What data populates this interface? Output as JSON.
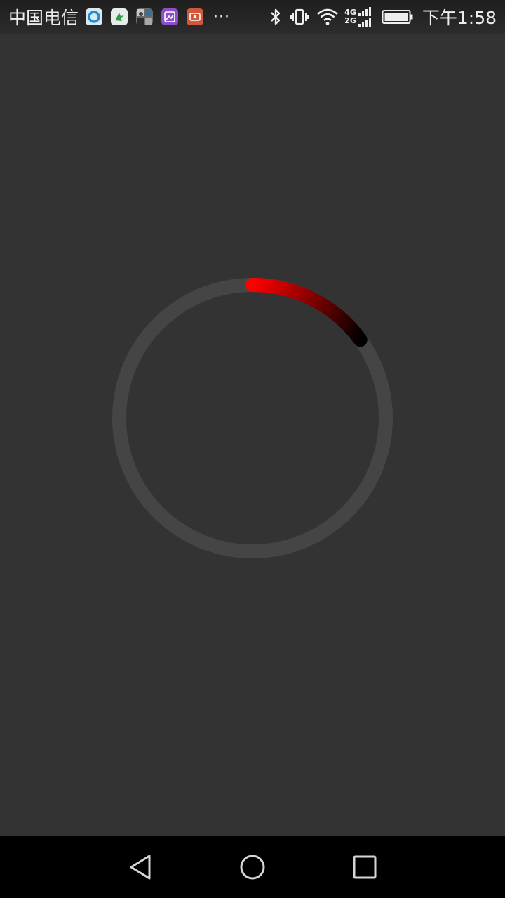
{
  "status_bar": {
    "carrier": "中国电信",
    "notification_icons": [
      "browser-icon",
      "bird-icon",
      "photos-icon",
      "gallery-icon",
      "screen-recorder-icon"
    ],
    "more": "···",
    "network_type_top": "4G",
    "network_type_bottom": "2G",
    "time": "下午1:58"
  },
  "progress": {
    "value": 0.15,
    "track_color": "#454545",
    "start_color": "#ff0000",
    "end_color": "#000000"
  },
  "nav_bar": {
    "icons": [
      "back-icon",
      "home-icon",
      "recents-icon"
    ]
  }
}
